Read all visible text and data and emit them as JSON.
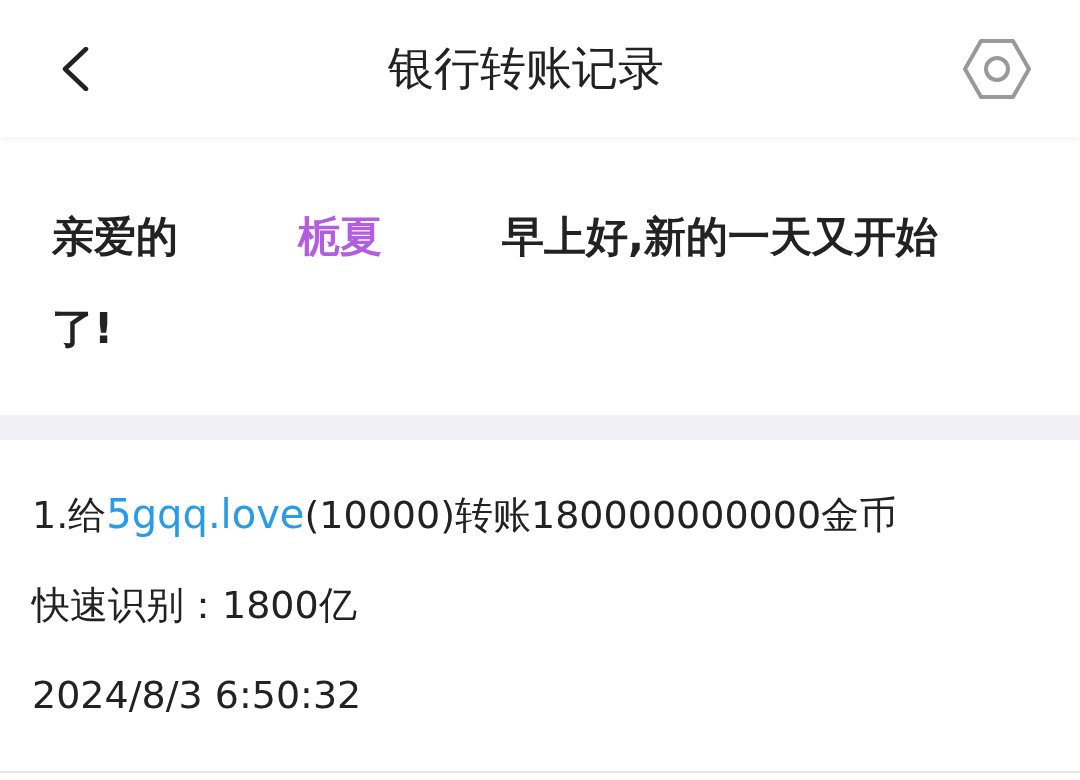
{
  "header": {
    "title": "银行转账记录"
  },
  "greeting": {
    "salutation": "亲爱的",
    "name": "栀夏",
    "message": "早上好,新的一天又开始了!"
  },
  "records": [
    {
      "prefix": "1.给",
      "user": "5gqq.love",
      "detail": "(10000)转账180000000000金币",
      "quick": "快速识别：1800亿",
      "time": "2024/8/3 6:50:32"
    }
  ]
}
